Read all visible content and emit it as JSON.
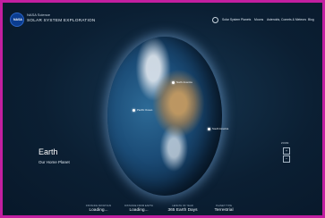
{
  "header": {
    "logo_text": "NASA",
    "subtitle": "NASA Science",
    "title": "SOLAR SYSTEM EXPLORATION",
    "nav": [
      "Solar System",
      "Planets",
      "Moons",
      "Asteroids, Comets & Meteors",
      "Blog"
    ]
  },
  "planet": {
    "name": "Earth",
    "tagline": "Our Home Planet",
    "markers": [
      "North America",
      "Pacific Ocean",
      "South America"
    ]
  },
  "zoom": {
    "label": "ZOOM",
    "plus": "+",
    "minus": "−"
  },
  "stats": [
    {
      "label": "DISTANCE FROM SUN",
      "value": "Loading..."
    },
    {
      "label": "DISTANCE FROM EARTH",
      "value": "Loading..."
    },
    {
      "label": "LENGTH OF YEAR",
      "value": "365 Earth Days"
    },
    {
      "label": "PLANET TYPE",
      "value": "Terrestrial"
    }
  ],
  "colors": {
    "frame_border": "#c21fa0",
    "background": "#0b1f33",
    "nasa_blue": "#0b3d91"
  }
}
